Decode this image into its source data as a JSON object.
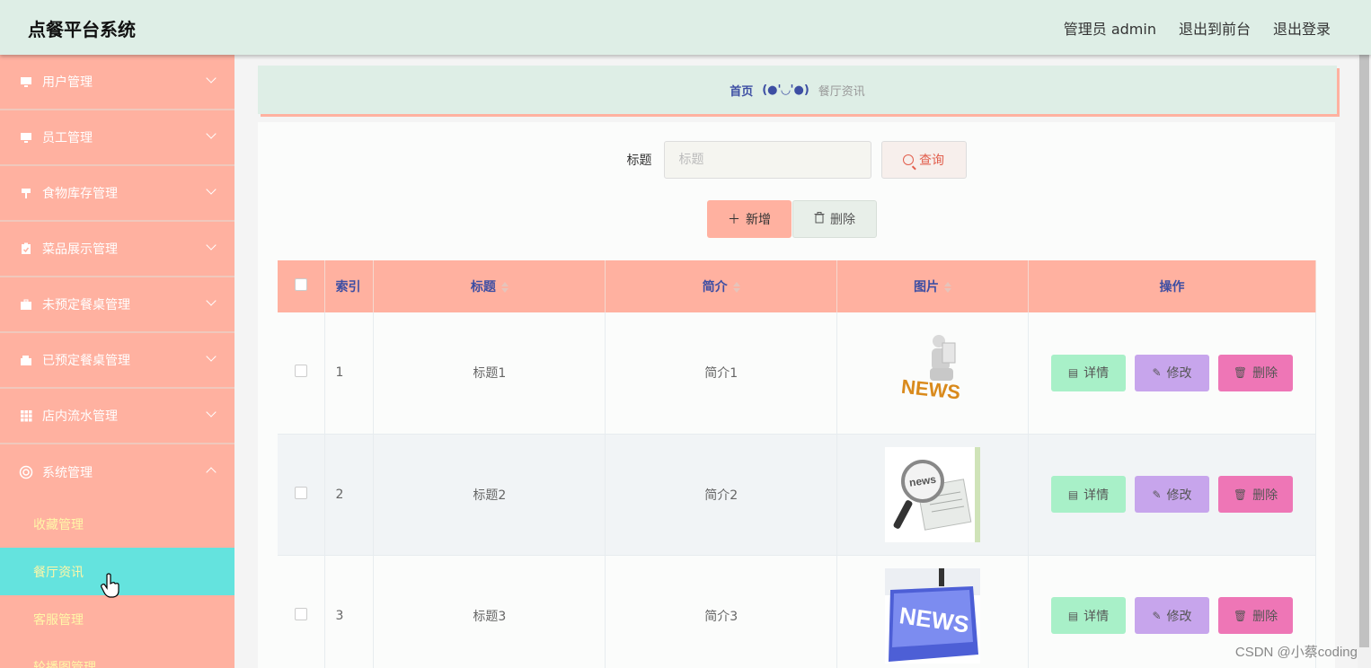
{
  "app": {
    "title": "点餐平台系统",
    "user_label": "管理员 admin",
    "to_front_label": "退出到前台",
    "logout_label": "退出登录"
  },
  "sidebar": {
    "items": [
      {
        "label": "用户管理",
        "icon": "monitor-icon"
      },
      {
        "label": "员工管理",
        "icon": "monitor-icon"
      },
      {
        "label": "食物库存管理",
        "icon": "signpost-icon"
      },
      {
        "label": "菜品展示管理",
        "icon": "clipboard-check-icon"
      },
      {
        "label": "未预定餐桌管理",
        "icon": "briefcase-icon"
      },
      {
        "label": "已预定餐桌管理",
        "icon": "wallet-icon"
      },
      {
        "label": "店内流水管理",
        "icon": "grid-icon"
      },
      {
        "label": "系统管理",
        "icon": "lifebuoy-icon",
        "expanded": true
      }
    ],
    "sub_items": [
      {
        "label": "收藏管理"
      },
      {
        "label": "餐厅资讯",
        "active": true
      },
      {
        "label": "客服管理"
      },
      {
        "label": "轮播图管理"
      }
    ]
  },
  "breadcrumb": {
    "home": "首页",
    "separator": "(●'◡'●)",
    "current": "餐厅资讯"
  },
  "search": {
    "label": "标题",
    "placeholder": "标题",
    "value": "",
    "button_label": "查询"
  },
  "actions": {
    "add_label": "新增",
    "delete_label": "删除"
  },
  "table": {
    "headers": {
      "index": "索引",
      "title": "标题",
      "intro": "简介",
      "picture": "图片",
      "operations": "操作"
    },
    "rows": [
      {
        "index": "1",
        "title": "标题1",
        "intro": "简介1",
        "picture": "news-figure-image"
      },
      {
        "index": "2",
        "title": "标题2",
        "intro": "简介2",
        "picture": "news-magnifier-image"
      },
      {
        "index": "3",
        "title": "标题3",
        "intro": "简介3",
        "picture": "news-key-image"
      }
    ],
    "op_labels": {
      "detail": "详情",
      "edit": "修改",
      "remove": "删除"
    }
  },
  "watermark": "CSDN @小蔡coding",
  "colors": {
    "header_bg": "#deeee6",
    "sidebar_bg": "#ffb1a0",
    "sidebar_active": "#64e3de",
    "sub_item_text": "#fff7a8",
    "accent_blue": "#3d4ea3",
    "detail_btn": "#a8f0c8",
    "edit_btn": "#c7a5ec",
    "remove_btn": "#ee76b6"
  }
}
